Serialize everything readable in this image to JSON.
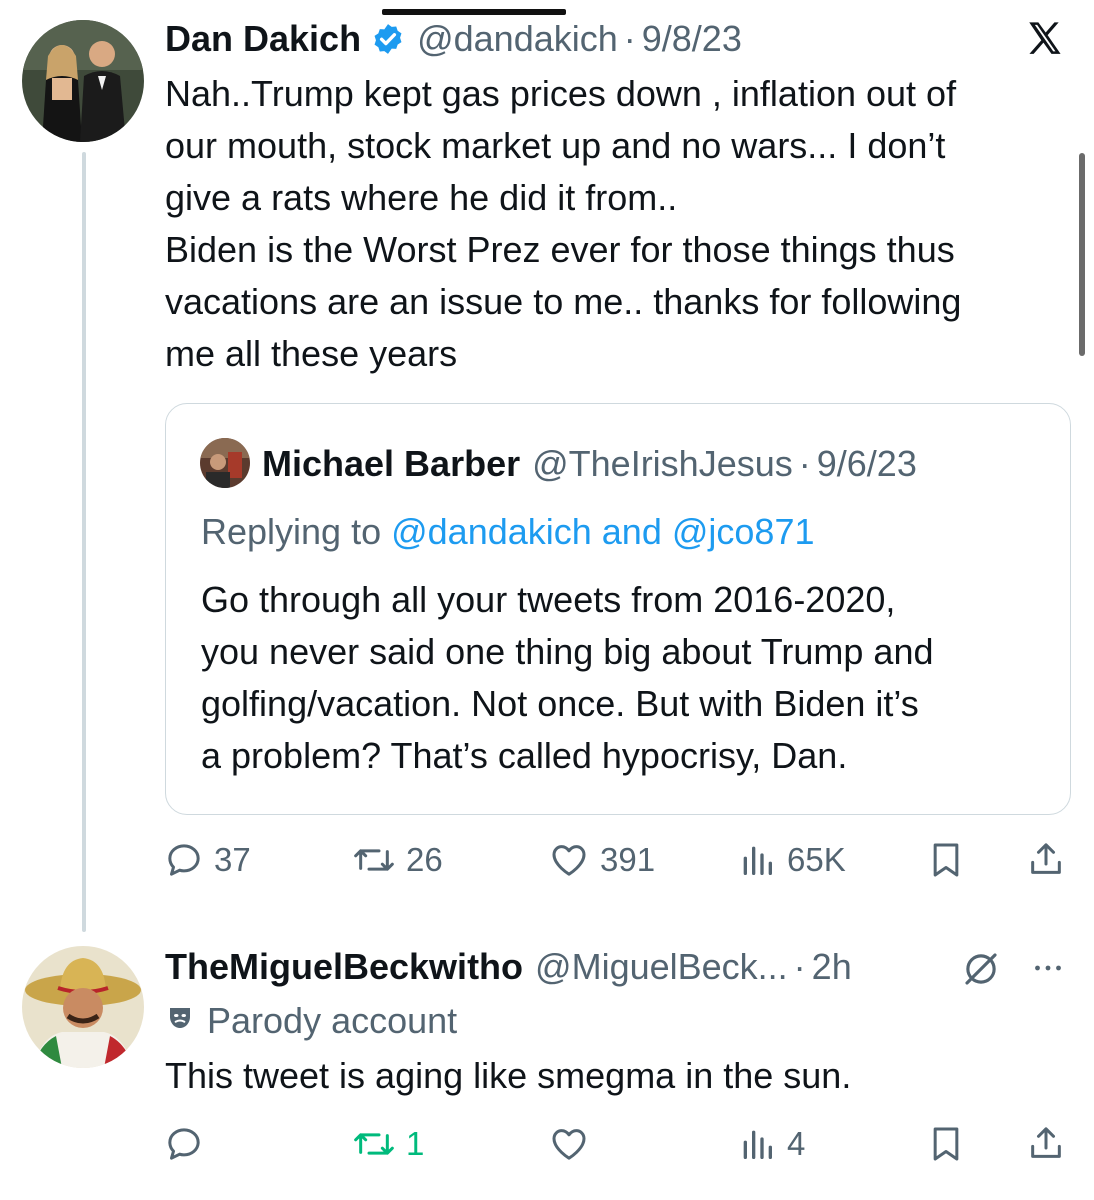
{
  "tweet": {
    "author_name": "Dan Dakich",
    "handle": "@dandakich",
    "separator": "·",
    "date": "9/8/23",
    "text_lines": [
      "Nah..Trump kept gas prices down , inflation out of",
      "our mouth, stock market up and no wars... I don’t",
      "give a rats where he  did it from..",
      "Biden is the Worst Prez ever for those things thus",
      "vacations are an issue to me.. thanks for following",
      "me all these years"
    ],
    "metrics": {
      "replies": "37",
      "reposts": "26",
      "likes": "391",
      "views": "65K"
    },
    "platform_icon": "x-logo-icon",
    "verified_icon": "verified-badge-icon"
  },
  "quote": {
    "author_name": "Michael Barber",
    "handle": "@TheIrishJesus",
    "separator": "·",
    "date": "9/6/23",
    "replying_prefix": "Replying to ",
    "replying_user1": "@dandakich",
    "replying_and": " and ",
    "replying_user2": "@jco871",
    "text_lines": [
      "Go through all your tweets from 2016-2020,",
      "you never said one thing big about Trump and",
      "golfing/vacation. Not once. But with Biden it’s",
      "a problem? That’s called hypocrisy, Dan."
    ]
  },
  "reply": {
    "author_name": "TheMiguelBeckwitho",
    "handle": "@MiguelBeck...",
    "separator": "·",
    "time": "2h",
    "parody_label": "Parody account",
    "text": "This tweet is aging like smegma in the sun.",
    "metrics": {
      "reposts": "1",
      "views": "4"
    },
    "more_icon": "more-options-icon",
    "grok_icon": "slash-circle-icon"
  },
  "colors": {
    "text": "#0f1419",
    "muted": "#536471",
    "link": "#1d9bf0",
    "verified": "#1d9bf0",
    "repost_active": "#00ba7c",
    "border": "#cfd9de"
  }
}
